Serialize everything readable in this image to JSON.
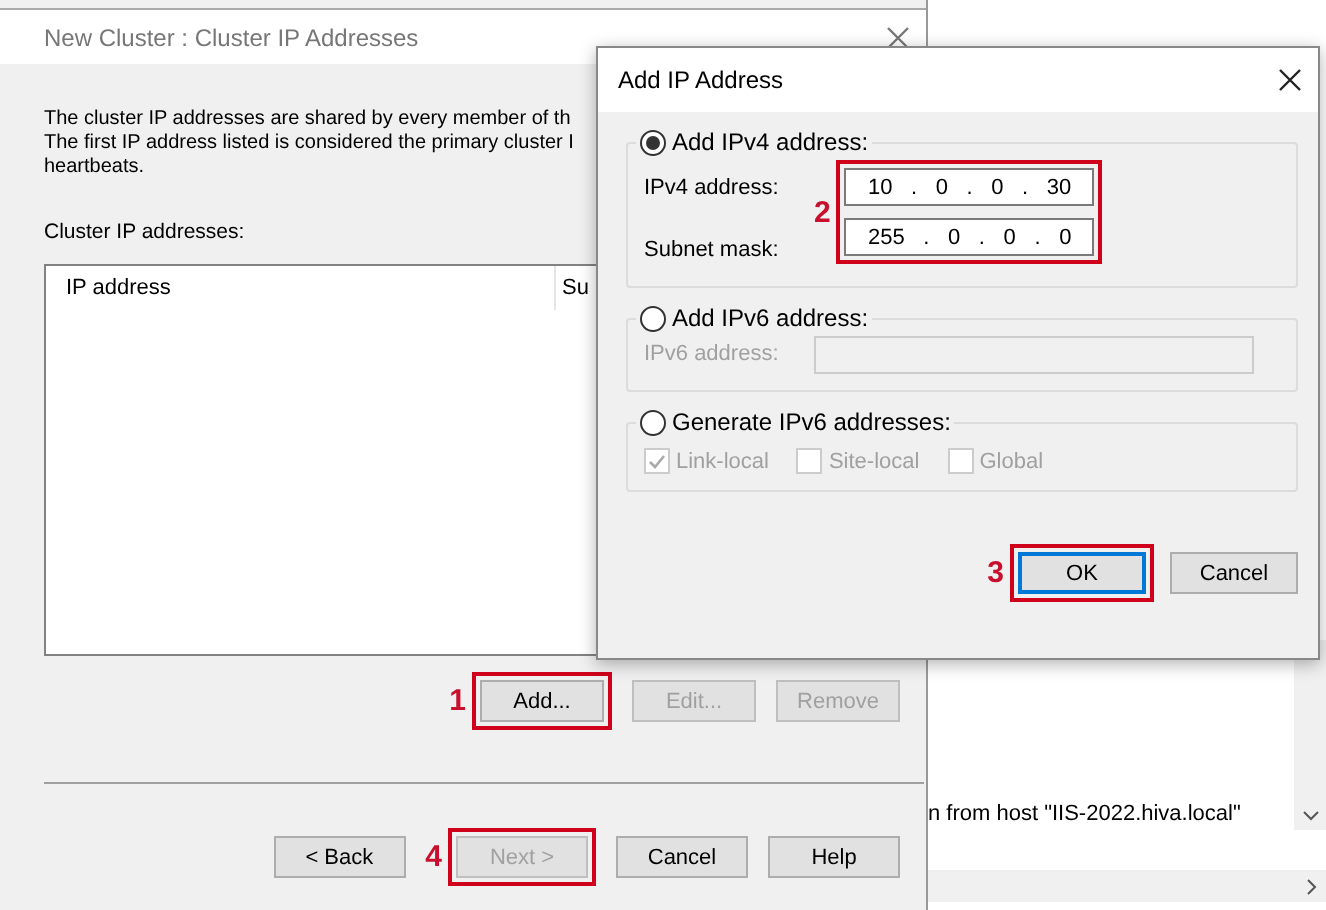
{
  "wizard": {
    "title": "New Cluster : Cluster IP Addresses",
    "description": [
      "The cluster IP addresses are shared by every member of th",
      "The first IP address listed is considered the primary cluster I",
      "heartbeats."
    ],
    "list_label": "Cluster IP addresses:",
    "list_columns": [
      "IP address",
      "Su"
    ],
    "buttons": [
      {
        "label": "Add...",
        "disabled": false,
        "step": "1"
      },
      {
        "label": "Edit...",
        "disabled": true
      },
      {
        "label": "Remove",
        "disabled": true
      }
    ],
    "nav_buttons": [
      {
        "label": "< Back",
        "disabled": false
      },
      {
        "label": "Next >",
        "disabled": true,
        "step": "4"
      },
      {
        "label": "Cancel",
        "disabled": false
      },
      {
        "label": "Help",
        "disabled": false
      }
    ]
  },
  "dialog": {
    "title": "Add IP Address",
    "groups": [
      {
        "kind": "ipv4",
        "label": "Add IPv4 address:",
        "selected": true,
        "step": "2",
        "fields": [
          {
            "label": "IPv4 address:",
            "parts": [
              "10",
              ".",
              "0",
              ".",
              "0",
              ".",
              "30"
            ]
          },
          {
            "label": "Subnet mask:",
            "parts": [
              "255",
              ".",
              "0",
              ".",
              "0",
              ".",
              "0"
            ]
          }
        ]
      },
      {
        "kind": "ipv6",
        "label": "Add IPv6 address:",
        "selected": false,
        "field_label": "IPv6 address:",
        "disabled": true
      },
      {
        "kind": "generate",
        "label": "Generate IPv6 addresses:",
        "selected": false,
        "checkboxes": [
          {
            "label": "Link-local",
            "checked": true,
            "disabled": true
          },
          {
            "label": "Site-local",
            "checked": false,
            "disabled": true
          },
          {
            "label": "Global",
            "checked": false,
            "disabled": true
          }
        ]
      }
    ],
    "buttons": [
      {
        "label": "OK",
        "default": true,
        "step": "3"
      },
      {
        "label": "Cancel",
        "default": false
      }
    ]
  },
  "backdrop": {
    "log_line": "n from host \"IIS-2022.hiva.local\""
  }
}
